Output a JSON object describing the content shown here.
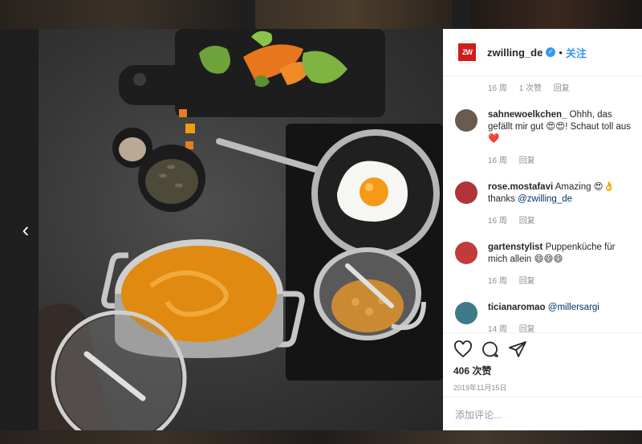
{
  "nav": {
    "prev_glyph": "‹"
  },
  "post": {
    "username": "zwilling_de",
    "follow_label": "关注",
    "logo_text": "ZW",
    "top_meta": {
      "age": "16 周",
      "likes": "1 次赞",
      "reply": "回复"
    },
    "comments": [
      {
        "user": "sahnewoelkchen_",
        "text": "Ohhh, das gefällt mir gut 😍😍! Schaut toll aus ❤️",
        "mention": "",
        "age": "16 周",
        "reply": "回复",
        "avatar_color": "#6b5a4e"
      },
      {
        "user": "rose.mostafavi",
        "text": "Amazing 😍👌 thanks ",
        "mention": "@zwilling_de",
        "age": "16 周",
        "reply": "回复",
        "avatar_color": "#b0343a"
      },
      {
        "user": "gartenstylist",
        "text": "Puppenküche für mich allein 😄😄😄",
        "mention": "",
        "age": "16 周",
        "reply": "回复",
        "avatar_color": "#c23a3a"
      },
      {
        "user": "ticianaromao",
        "text": "",
        "mention": "@millersargi",
        "age": "14 周",
        "reply": "回复",
        "avatar_color": "#3e7a8a"
      }
    ],
    "likes_count": "406 次赞",
    "date": "2019年11月15日",
    "add_comment_placeholder": "添加评论..."
  },
  "colors": {
    "accent": "#3897f0",
    "brand": "#d01c1c"
  },
  "icons": [
    "heart-icon",
    "comment-icon",
    "share-icon",
    "verified-icon",
    "chevron-left-icon"
  ]
}
